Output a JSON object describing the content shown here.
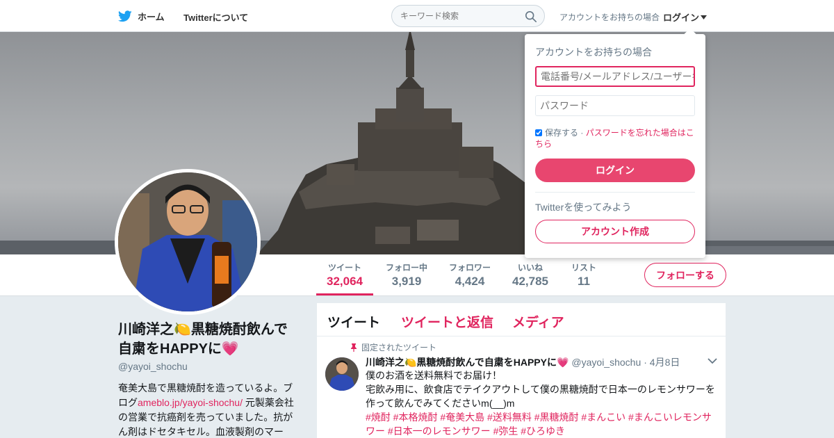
{
  "nav": {
    "home_label": "ホーム",
    "about_label": "Twitterについて",
    "search_placeholder": "キーワード検索",
    "login_prompt": "アカウントをお持ちの場合",
    "login_label": "ログイン",
    "brand_color": "#1da1f2"
  },
  "stats": [
    {
      "label": "ツイート",
      "value": "32,064"
    },
    {
      "label": "フォロー中",
      "value": "3,919"
    },
    {
      "label": "フォロワー",
      "value": "4,424"
    },
    {
      "label": "いいね",
      "value": "42,785"
    },
    {
      "label": "リスト",
      "value": "11"
    }
  ],
  "follow_button": "フォローする",
  "profile": {
    "name": "川崎洋之🍋黒糖焼酎飲んで自粛をHAPPYに💗",
    "handle": "@yayoi_shochu",
    "bio_1": "奄美大島で黒糖焼酎を造っているよ。ブログ",
    "bio_link": "ameblo.jp/yayoi-shochu/",
    "bio_2": " 元製薬会社の営業で抗癌剤を売っていました。抗がん剤はドセタキセル。血液製剤のマー"
  },
  "timeline": {
    "tabs": [
      "ツイート",
      "ツイートと返信",
      "メディア"
    ],
    "pinned_label": "固定されたツイート",
    "tweet": {
      "name": "川崎洋之🍋黒糖焼酎飲んで自粛をHAPPYに💗",
      "handle": "@yayoi_shochu",
      "time": "· 4月8日",
      "line1": "僕のお酒を送料無料でお届け！",
      "line2": "宅飲み用に、飲食店でテイクアウトして僕の黒糖焼酎で日本一のレモンサワーを作って飲んでみてくださいm(__)m",
      "tags": "#焼酎 #本格焼酎 #奄美大島 #送料無料 #黒糖焼酎 #まんこい #まんこいレモンサワー #日本一のレモンサワー #弥生 #ひろゆき"
    }
  },
  "login_dropdown": {
    "title": "アカウントをお持ちの場合",
    "user_placeholder": "電話番号/メールアドレス/ユーザー名",
    "password_placeholder": "パスワード",
    "remember_label": "保存する",
    "separator": " · ",
    "forgot_label": "パスワードを忘れた場合はこちら",
    "login_button": "ログイン",
    "try_label": "Twitterを使ってみよう",
    "create_button": "アカウント作成",
    "accent_color": "#e0245e"
  }
}
